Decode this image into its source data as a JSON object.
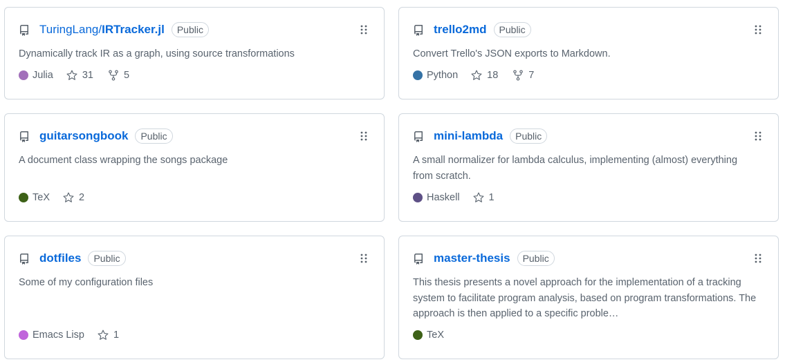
{
  "cards": [
    {
      "owner": "TuringLang/",
      "repo": "IRTracker.jl",
      "visibility": "Public",
      "description": "Dynamically track IR as a graph, using source transformations",
      "language": "Julia",
      "language_color": "#a270ba",
      "stars": "31",
      "forks": "5"
    },
    {
      "owner": "",
      "repo": "trello2md",
      "visibility": "Public",
      "description": "Convert Trello's JSON exports to Markdown.",
      "language": "Python",
      "language_color": "#3572a5",
      "stars": "18",
      "forks": "7"
    },
    {
      "owner": "",
      "repo": "guitarsongbook",
      "visibility": "Public",
      "description": "A document class wrapping the songs package",
      "language": "TeX",
      "language_color": "#3d6117",
      "stars": "2"
    },
    {
      "owner": "",
      "repo": "mini-lambda",
      "visibility": "Public",
      "description": "A small normalizer for lambda calculus, implementing (almost) everything from scratch.",
      "language": "Haskell",
      "language_color": "#5e5086",
      "stars": "1"
    },
    {
      "owner": "",
      "repo": "dotfiles",
      "visibility": "Public",
      "description": "Some of my configuration files",
      "language": "Emacs Lisp",
      "language_color": "#c065db",
      "stars": "1"
    },
    {
      "owner": "",
      "repo": "master-thesis",
      "visibility": "Public",
      "description": "This thesis presents a novel approach for the implementation of a tracking system to facilitate program analysis, based on program transformations. The approach is then applied to a specific proble…",
      "language": "TeX",
      "language_color": "#3d6117"
    }
  ]
}
